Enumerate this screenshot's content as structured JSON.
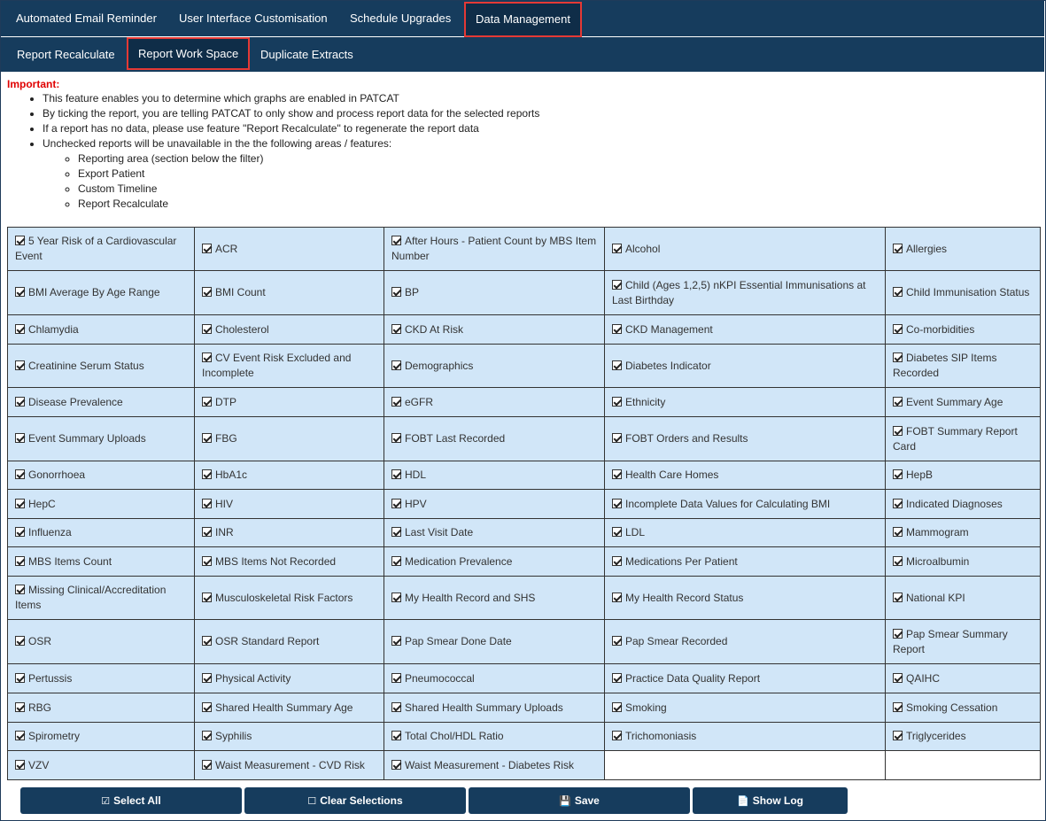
{
  "top_tabs": [
    {
      "label": "Automated Email Reminder"
    },
    {
      "label": "User Interface Customisation"
    },
    {
      "label": "Schedule Upgrades"
    },
    {
      "label": "Data Management"
    }
  ],
  "sub_tabs": [
    {
      "label": "Report Recalculate"
    },
    {
      "label": "Report Work Space"
    },
    {
      "label": "Duplicate Extracts"
    }
  ],
  "important": {
    "title": "Important:",
    "items": [
      "This feature enables you to determine which graphs are enabled in PATCAT",
      "By ticking the report, you are telling PATCAT to only show and process report data for the selected reports",
      "If a report has no data, please use feature \"Report Recalculate\" to regenerate the report data",
      "Unchecked reports will be unavailable in the the following areas / features:"
    ],
    "sub_items": [
      "Reporting area (section below the filter)",
      "Export Patient",
      "Custom Timeline",
      "Report Recalculate"
    ]
  },
  "reports": [
    [
      "5 Year Risk of a Cardiovascular Event",
      "ACR",
      "After Hours - Patient Count by MBS Item Number",
      "Alcohol",
      "Allergies"
    ],
    [
      "BMI Average By Age Range",
      "BMI Count",
      "BP",
      "Child (Ages 1,2,5) nKPI Essential Immunisations at Last Birthday",
      "Child Immunisation Status"
    ],
    [
      "Chlamydia",
      "Cholesterol",
      "CKD At Risk",
      "CKD Management",
      "Co-morbidities"
    ],
    [
      "Creatinine Serum Status",
      "CV Event Risk Excluded and Incomplete",
      "Demographics",
      "Diabetes Indicator",
      "Diabetes SIP Items Recorded"
    ],
    [
      "Disease Prevalence",
      "DTP",
      "eGFR",
      "Ethnicity",
      "Event Summary Age"
    ],
    [
      "Event Summary Uploads",
      "FBG",
      "FOBT Last Recorded",
      "FOBT Orders and Results",
      "FOBT Summary Report Card"
    ],
    [
      "Gonorrhoea",
      "HbA1c",
      "HDL",
      "Health Care Homes",
      "HepB"
    ],
    [
      "HepC",
      "HIV",
      "HPV",
      "Incomplete Data Values for Calculating BMI",
      "Indicated Diagnoses"
    ],
    [
      "Influenza",
      "INR",
      "Last Visit Date",
      "LDL",
      "Mammogram"
    ],
    [
      "MBS Items Count",
      "MBS Items Not Recorded",
      "Medication Prevalence",
      "Medications Per Patient",
      "Microalbumin"
    ],
    [
      "Missing Clinical/Accreditation Items",
      "Musculoskeletal Risk Factors",
      "My Health Record and SHS",
      "My Health Record Status",
      "National KPI"
    ],
    [
      "OSR",
      "OSR Standard Report",
      "Pap Smear Done Date",
      "Pap Smear Recorded",
      "Pap Smear Summary Report"
    ],
    [
      "Pertussis",
      "Physical Activity",
      "Pneumococcal",
      "Practice Data Quality Report",
      "QAIHC"
    ],
    [
      "RBG",
      "Shared Health Summary Age",
      "Shared Health Summary Uploads",
      "Smoking",
      "Smoking Cessation"
    ],
    [
      "Spirometry",
      "Syphilis",
      "Total Chol/HDL Ratio",
      "Trichomoniasis",
      "Triglycerides"
    ],
    [
      "VZV",
      "Waist Measurement - CVD Risk",
      "Waist Measurement - Diabetes Risk",
      "",
      ""
    ]
  ],
  "buttons": {
    "select_all": "Select All",
    "clear": "Clear Selections",
    "save": "Save",
    "show_log": "Show Log"
  },
  "colors": {
    "nav_bg": "#163c5d",
    "active_border": "#e53935",
    "cell_bg": "#d1e6f8",
    "important": "#e00000"
  }
}
